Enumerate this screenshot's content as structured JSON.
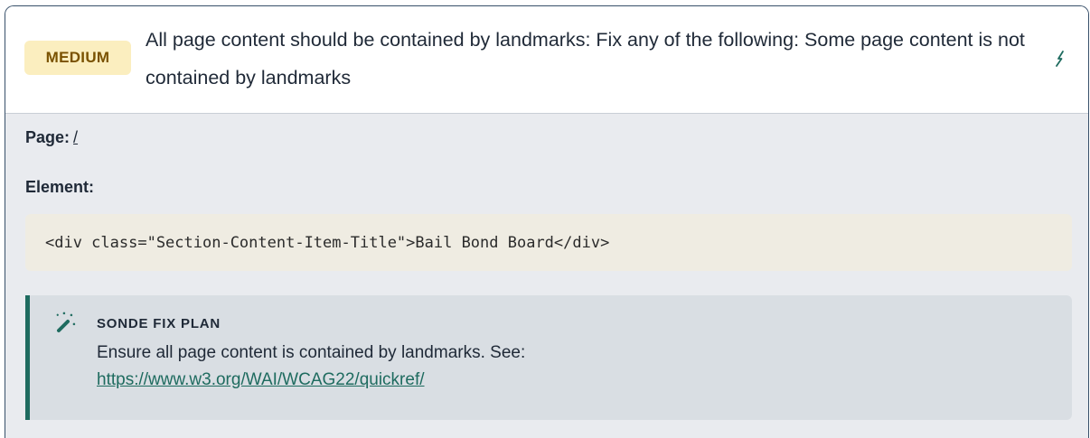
{
  "issue": {
    "severity_badge": "MEDIUM",
    "title": "All page content should be contained by landmarks: Fix any of the following: Some page content is not contained by landmarks",
    "toggle_icon": "lightning-icon"
  },
  "details": {
    "page_label": "Page:",
    "page_link": "/",
    "element_label": "Element:",
    "element_code": "<div class=\"Section-Content-Item-Title\">Bail Bond Board</div>"
  },
  "fix_plan": {
    "icon": "magic-wand-icon",
    "heading": "SONDE FIX PLAN",
    "text": "Ensure all page content is contained by landmarks. See:",
    "link": "https://www.w3.org/WAI/WCAG22/quickref/"
  },
  "colors": {
    "badge_bg": "#fbeebf",
    "badge_text": "#7a5200",
    "accent": "#1e6b5f",
    "card_border": "#38506a"
  }
}
